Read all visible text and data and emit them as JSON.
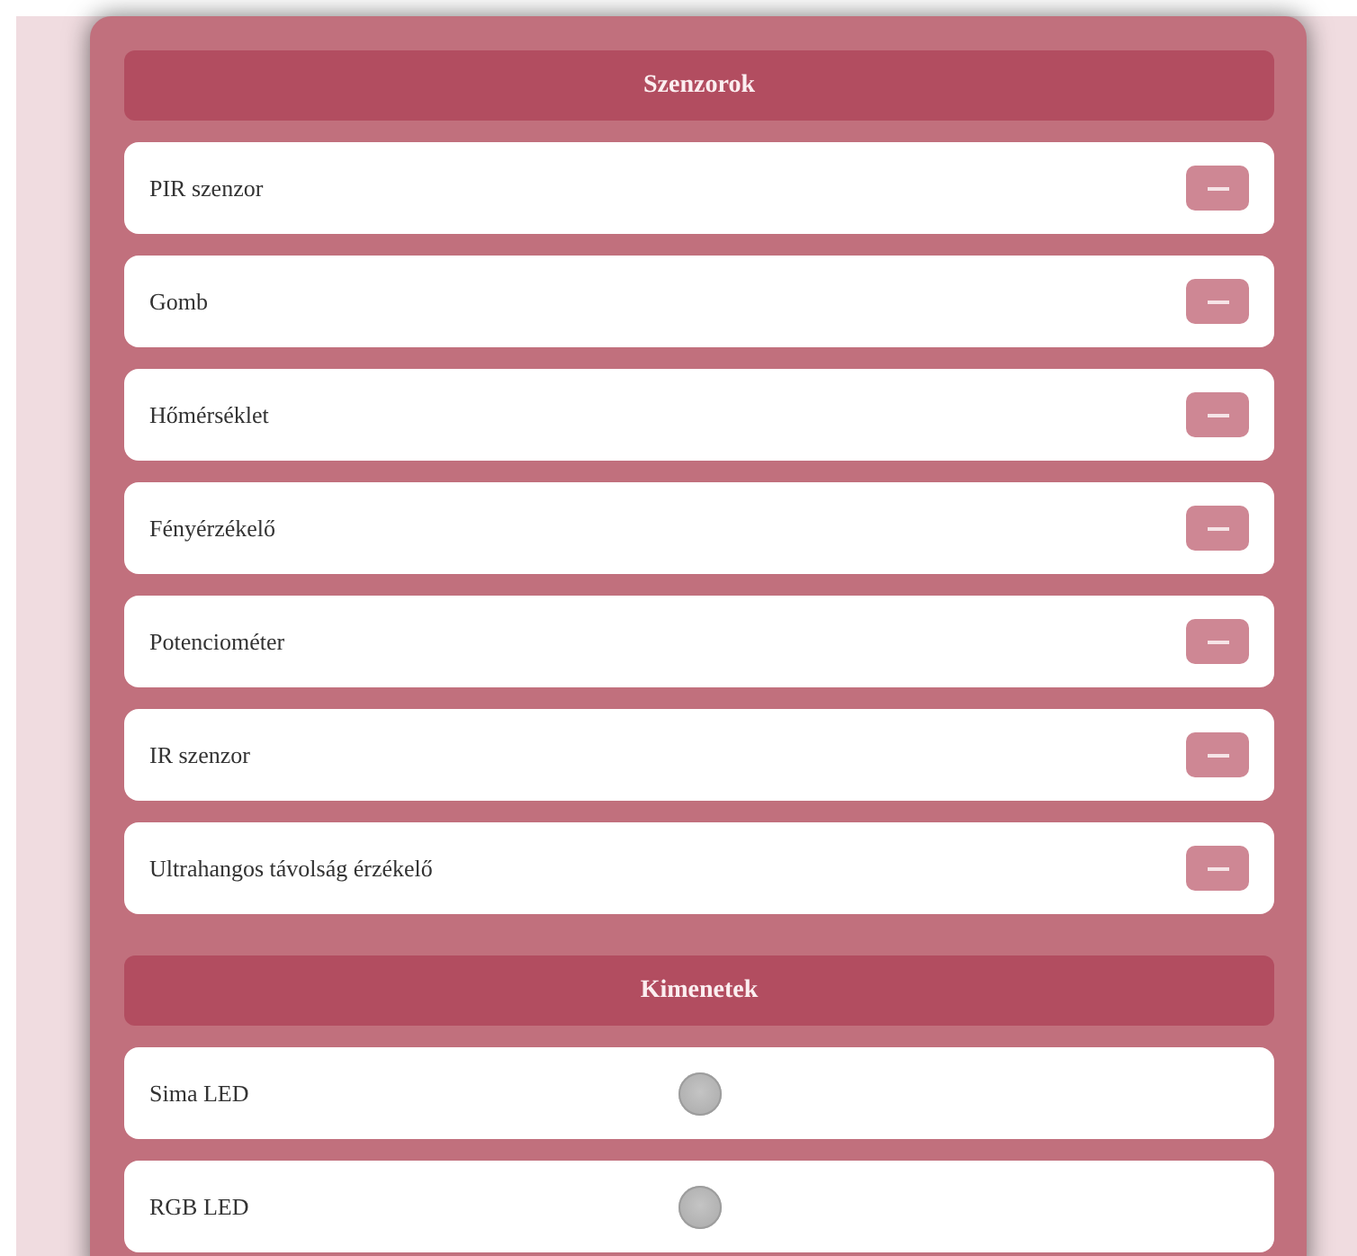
{
  "sections": [
    {
      "title": "Szenzorok",
      "items": [
        {
          "kind": "sensor",
          "label": "PIR szenzor"
        },
        {
          "kind": "sensor",
          "label": "Gomb"
        },
        {
          "kind": "sensor",
          "label": "Hőmérséklet"
        },
        {
          "kind": "sensor",
          "label": "Fényérzékelő"
        },
        {
          "kind": "sensor",
          "label": "Potenciométer"
        },
        {
          "kind": "sensor",
          "label": "IR szenzor"
        },
        {
          "kind": "sensor",
          "label": "Ultrahangos távolság érzékelő"
        }
      ]
    },
    {
      "title": "Kimenetek",
      "items": [
        {
          "kind": "led",
          "label": "Sima LED",
          "on": false
        },
        {
          "kind": "led",
          "label": "RGB LED",
          "on": false
        }
      ]
    }
  ]
}
